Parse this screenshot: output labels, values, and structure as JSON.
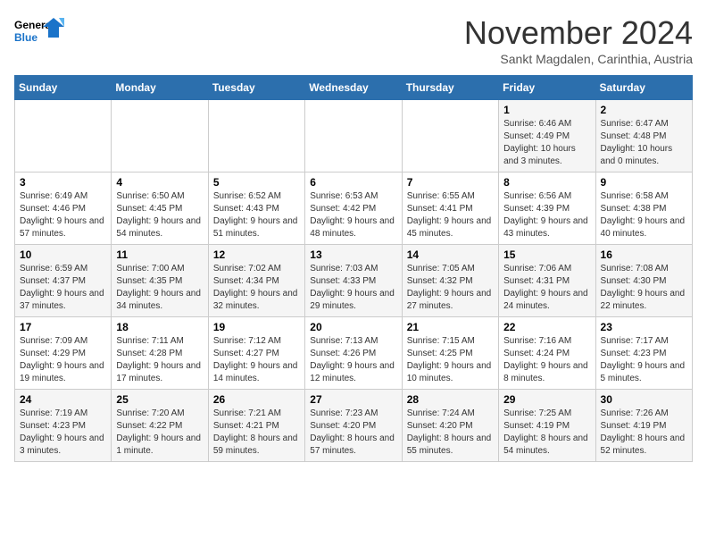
{
  "logo": {
    "line1": "General",
    "line2": "Blue"
  },
  "title": "November 2024",
  "location": "Sankt Magdalen, Carinthia, Austria",
  "weekdays": [
    "Sunday",
    "Monday",
    "Tuesday",
    "Wednesday",
    "Thursday",
    "Friday",
    "Saturday"
  ],
  "weeks": [
    [
      {
        "day": "",
        "info": ""
      },
      {
        "day": "",
        "info": ""
      },
      {
        "day": "",
        "info": ""
      },
      {
        "day": "",
        "info": ""
      },
      {
        "day": "",
        "info": ""
      },
      {
        "day": "1",
        "info": "Sunrise: 6:46 AM\nSunset: 4:49 PM\nDaylight: 10 hours and 3 minutes."
      },
      {
        "day": "2",
        "info": "Sunrise: 6:47 AM\nSunset: 4:48 PM\nDaylight: 10 hours and 0 minutes."
      }
    ],
    [
      {
        "day": "3",
        "info": "Sunrise: 6:49 AM\nSunset: 4:46 PM\nDaylight: 9 hours and 57 minutes."
      },
      {
        "day": "4",
        "info": "Sunrise: 6:50 AM\nSunset: 4:45 PM\nDaylight: 9 hours and 54 minutes."
      },
      {
        "day": "5",
        "info": "Sunrise: 6:52 AM\nSunset: 4:43 PM\nDaylight: 9 hours and 51 minutes."
      },
      {
        "day": "6",
        "info": "Sunrise: 6:53 AM\nSunset: 4:42 PM\nDaylight: 9 hours and 48 minutes."
      },
      {
        "day": "7",
        "info": "Sunrise: 6:55 AM\nSunset: 4:41 PM\nDaylight: 9 hours and 45 minutes."
      },
      {
        "day": "8",
        "info": "Sunrise: 6:56 AM\nSunset: 4:39 PM\nDaylight: 9 hours and 43 minutes."
      },
      {
        "day": "9",
        "info": "Sunrise: 6:58 AM\nSunset: 4:38 PM\nDaylight: 9 hours and 40 minutes."
      }
    ],
    [
      {
        "day": "10",
        "info": "Sunrise: 6:59 AM\nSunset: 4:37 PM\nDaylight: 9 hours and 37 minutes."
      },
      {
        "day": "11",
        "info": "Sunrise: 7:00 AM\nSunset: 4:35 PM\nDaylight: 9 hours and 34 minutes."
      },
      {
        "day": "12",
        "info": "Sunrise: 7:02 AM\nSunset: 4:34 PM\nDaylight: 9 hours and 32 minutes."
      },
      {
        "day": "13",
        "info": "Sunrise: 7:03 AM\nSunset: 4:33 PM\nDaylight: 9 hours and 29 minutes."
      },
      {
        "day": "14",
        "info": "Sunrise: 7:05 AM\nSunset: 4:32 PM\nDaylight: 9 hours and 27 minutes."
      },
      {
        "day": "15",
        "info": "Sunrise: 7:06 AM\nSunset: 4:31 PM\nDaylight: 9 hours and 24 minutes."
      },
      {
        "day": "16",
        "info": "Sunrise: 7:08 AM\nSunset: 4:30 PM\nDaylight: 9 hours and 22 minutes."
      }
    ],
    [
      {
        "day": "17",
        "info": "Sunrise: 7:09 AM\nSunset: 4:29 PM\nDaylight: 9 hours and 19 minutes."
      },
      {
        "day": "18",
        "info": "Sunrise: 7:11 AM\nSunset: 4:28 PM\nDaylight: 9 hours and 17 minutes."
      },
      {
        "day": "19",
        "info": "Sunrise: 7:12 AM\nSunset: 4:27 PM\nDaylight: 9 hours and 14 minutes."
      },
      {
        "day": "20",
        "info": "Sunrise: 7:13 AM\nSunset: 4:26 PM\nDaylight: 9 hours and 12 minutes."
      },
      {
        "day": "21",
        "info": "Sunrise: 7:15 AM\nSunset: 4:25 PM\nDaylight: 9 hours and 10 minutes."
      },
      {
        "day": "22",
        "info": "Sunrise: 7:16 AM\nSunset: 4:24 PM\nDaylight: 9 hours and 8 minutes."
      },
      {
        "day": "23",
        "info": "Sunrise: 7:17 AM\nSunset: 4:23 PM\nDaylight: 9 hours and 5 minutes."
      }
    ],
    [
      {
        "day": "24",
        "info": "Sunrise: 7:19 AM\nSunset: 4:23 PM\nDaylight: 9 hours and 3 minutes."
      },
      {
        "day": "25",
        "info": "Sunrise: 7:20 AM\nSunset: 4:22 PM\nDaylight: 9 hours and 1 minute."
      },
      {
        "day": "26",
        "info": "Sunrise: 7:21 AM\nSunset: 4:21 PM\nDaylight: 8 hours and 59 minutes."
      },
      {
        "day": "27",
        "info": "Sunrise: 7:23 AM\nSunset: 4:20 PM\nDaylight: 8 hours and 57 minutes."
      },
      {
        "day": "28",
        "info": "Sunrise: 7:24 AM\nSunset: 4:20 PM\nDaylight: 8 hours and 55 minutes."
      },
      {
        "day": "29",
        "info": "Sunrise: 7:25 AM\nSunset: 4:19 PM\nDaylight: 8 hours and 54 minutes."
      },
      {
        "day": "30",
        "info": "Sunrise: 7:26 AM\nSunset: 4:19 PM\nDaylight: 8 hours and 52 minutes."
      }
    ]
  ]
}
